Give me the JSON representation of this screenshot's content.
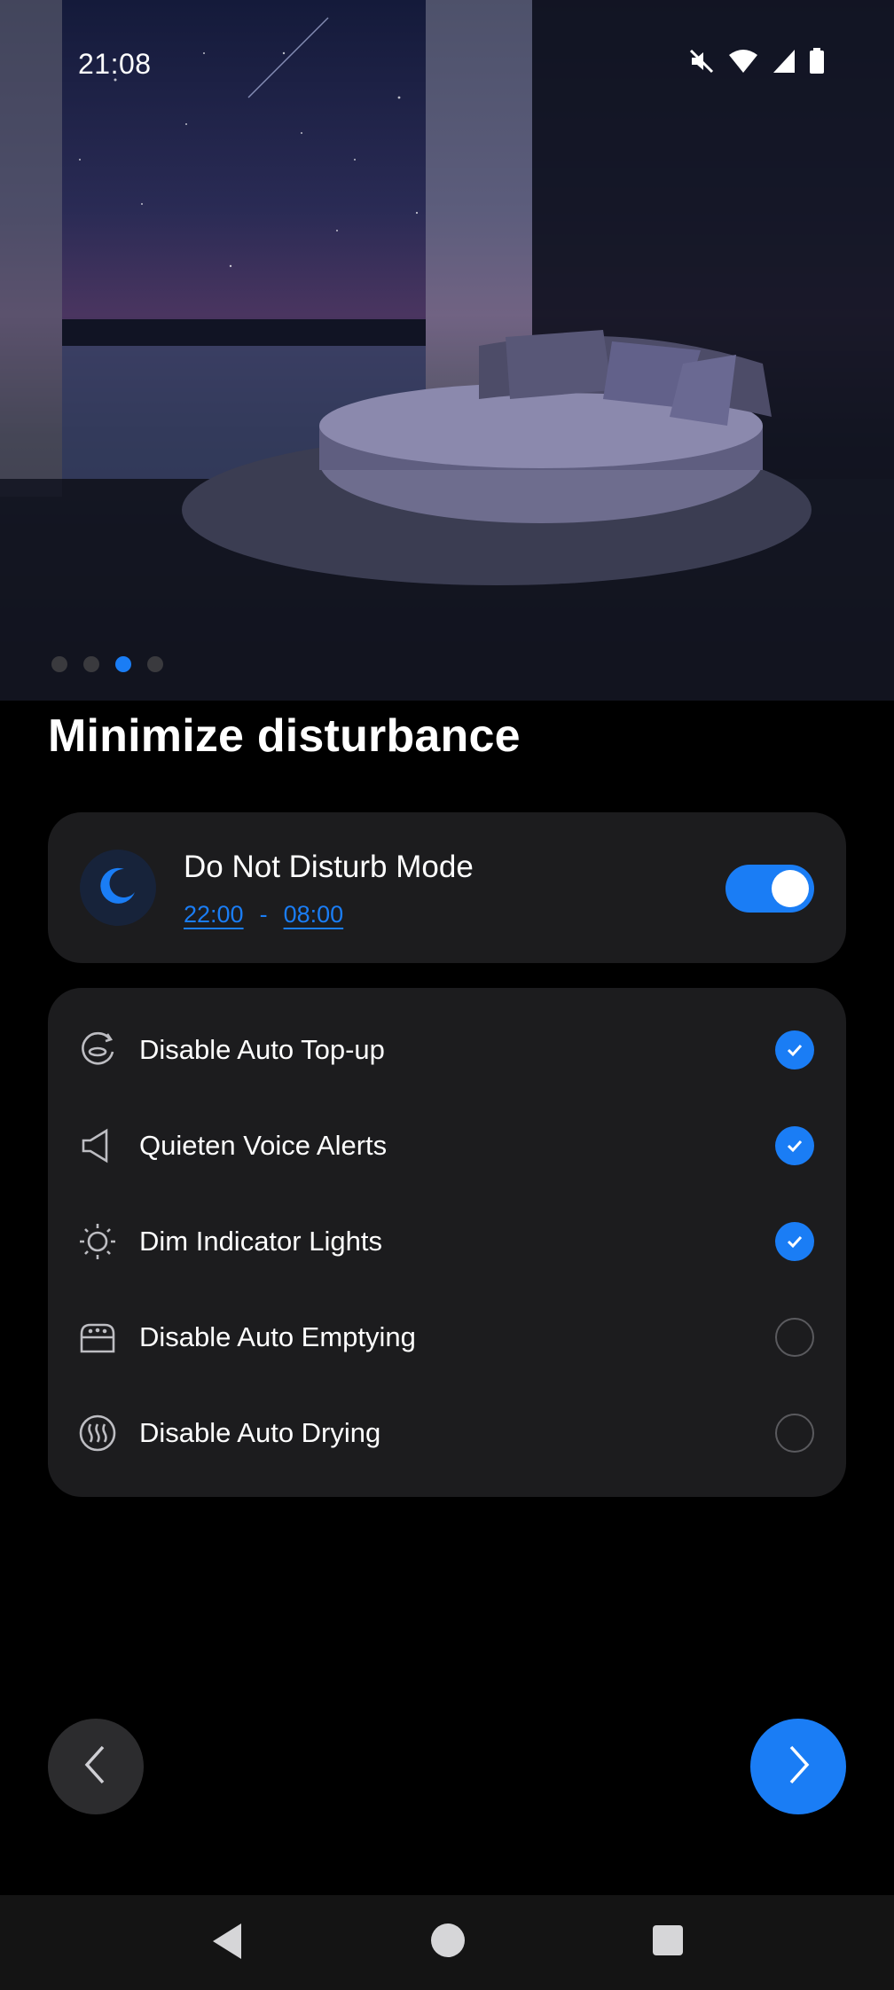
{
  "status_bar": {
    "time": "21:08",
    "icons": [
      "mute-icon",
      "wifi-icon",
      "signal-icon",
      "battery-icon"
    ]
  },
  "pager": {
    "count": 4,
    "active_index": 2
  },
  "title": "Minimize disturbance",
  "dnd": {
    "label": "Do Not Disturb Mode",
    "start": "22:00",
    "separator": "-",
    "end": "08:00",
    "enabled": true,
    "icon": "moon-icon"
  },
  "options": [
    {
      "label": "Disable Auto Top-up",
      "icon": "water-refill-icon",
      "checked": true
    },
    {
      "label": "Quieten Voice Alerts",
      "icon": "speaker-icon",
      "checked": true
    },
    {
      "label": "Dim Indicator Lights",
      "icon": "sun-icon",
      "checked": true
    },
    {
      "label": "Disable Auto Emptying",
      "icon": "dust-bin-icon",
      "checked": false
    },
    {
      "label": "Disable Auto Drying",
      "icon": "heat-waves-icon",
      "checked": false
    }
  ],
  "colors": {
    "accent": "#1a7df5",
    "card": "#1c1c1e",
    "background": "#000000"
  }
}
